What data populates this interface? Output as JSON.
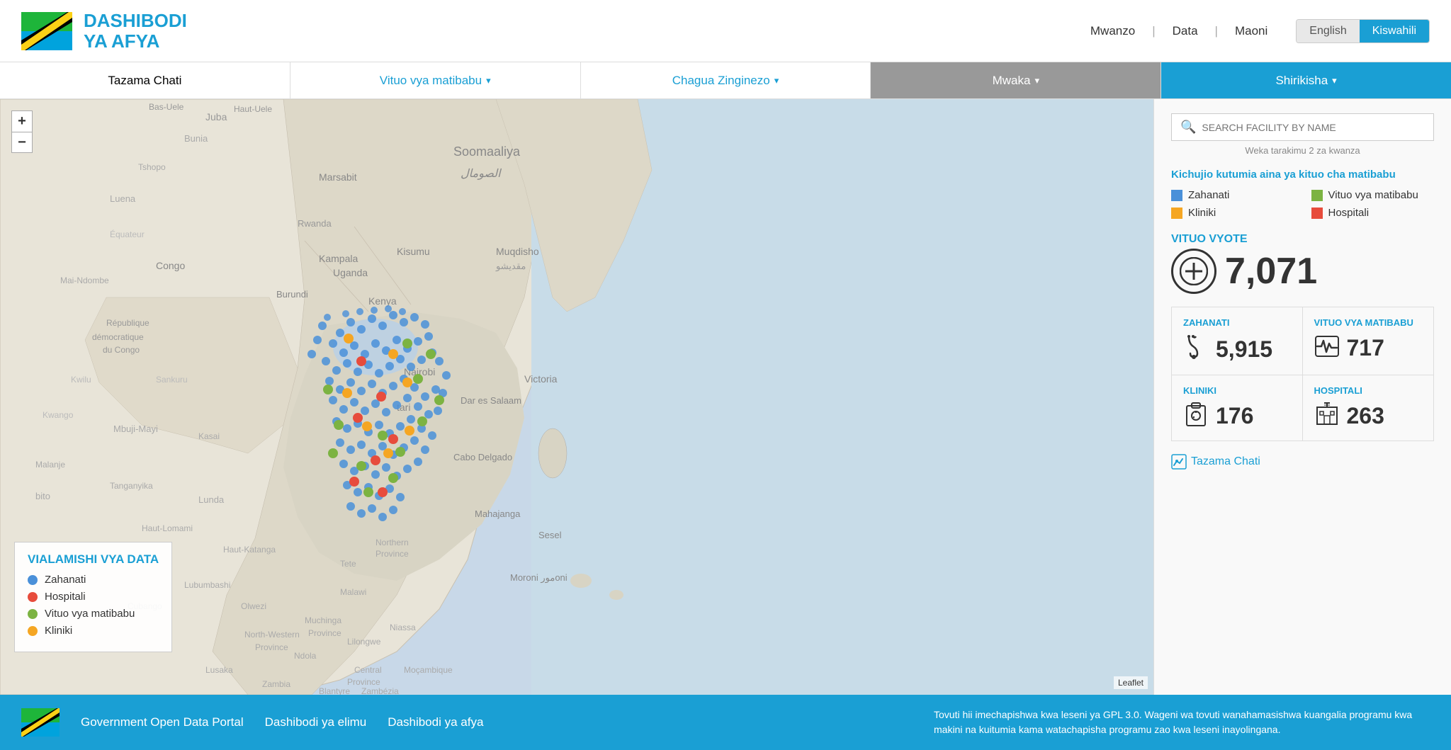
{
  "header": {
    "brand_line1": "DASHIBODI",
    "brand_line2": "YA AFYA",
    "nav_items": [
      "Mwanzo",
      "Data",
      "Maoni"
    ],
    "lang_english": "English",
    "lang_kiswahili": "Kiswahili"
  },
  "navbar": {
    "items": [
      {
        "label": "Tazama Chati",
        "active": false,
        "arrow": false,
        "style": "default"
      },
      {
        "label": "Vituo vya matibabu",
        "active": true,
        "arrow": true,
        "style": "default"
      },
      {
        "label": "Chagua Zinginezo",
        "active": true,
        "arrow": true,
        "style": "default"
      },
      {
        "label": "Mwaka",
        "active": false,
        "arrow": true,
        "style": "dark"
      },
      {
        "label": "Shirikisha",
        "active": false,
        "arrow": true,
        "style": "blue"
      }
    ]
  },
  "map": {
    "zoom_plus": "+",
    "zoom_minus": "−",
    "leaflet_label": "Leaflet",
    "legend_title": "VIALAMISHI VYA DATA",
    "legend_items": [
      {
        "label": "Zahanati",
        "color": "#4a90d9"
      },
      {
        "label": "Hospitali",
        "color": "#e74c3c"
      },
      {
        "label": "Vituo vya matibabu",
        "color": "#7cb342"
      },
      {
        "label": "Kliniki",
        "color": "#f5a623"
      }
    ]
  },
  "right_panel": {
    "search_placeholder": "SEARCH FACILITY BY NAME",
    "search_hint": "Weka tarakimu 2 za kwanza",
    "filter_title": "Kichujio kutumia aina ya kituo cha matibabu",
    "filter_items": [
      {
        "label": "Zahanati",
        "color": "#4a90d9",
        "shape": "square"
      },
      {
        "label": "Vituo vya matibabu",
        "color": "#7cb342",
        "shape": "square"
      },
      {
        "label": "Kliniki",
        "color": "#f5a623",
        "shape": "square"
      },
      {
        "label": "Hospitali",
        "color": "#e74c3c",
        "shape": "square"
      }
    ],
    "all_facilities_label": "VITUO VYOTE",
    "all_facilities_count": "7,071",
    "stats": [
      {
        "label": "ZAHANATI",
        "value": "5,915",
        "icon": "stethoscope"
      },
      {
        "label": "VITUO VYA MATIBABU",
        "value": "717",
        "icon": "ecg"
      },
      {
        "label": "KLINIKI",
        "value": "176",
        "icon": "clipboard"
      },
      {
        "label": "HOSPITALI",
        "value": "263",
        "icon": "hospital"
      }
    ],
    "tazama_link": "Tazama Chati"
  },
  "footer": {
    "link1": "Government Open Data Portal",
    "link2": "Dashibodi ya elimu",
    "link3": "Dashibodi ya afya",
    "disclaimer": "Tovuti hii imechapishwa kwa leseni ya GPL 3.0. Wageni wa tovuti wanahamasishwa kuangalia programu kwa makini na kuitumia kama watachapisha programu zao kwa leseni inayolingana."
  }
}
